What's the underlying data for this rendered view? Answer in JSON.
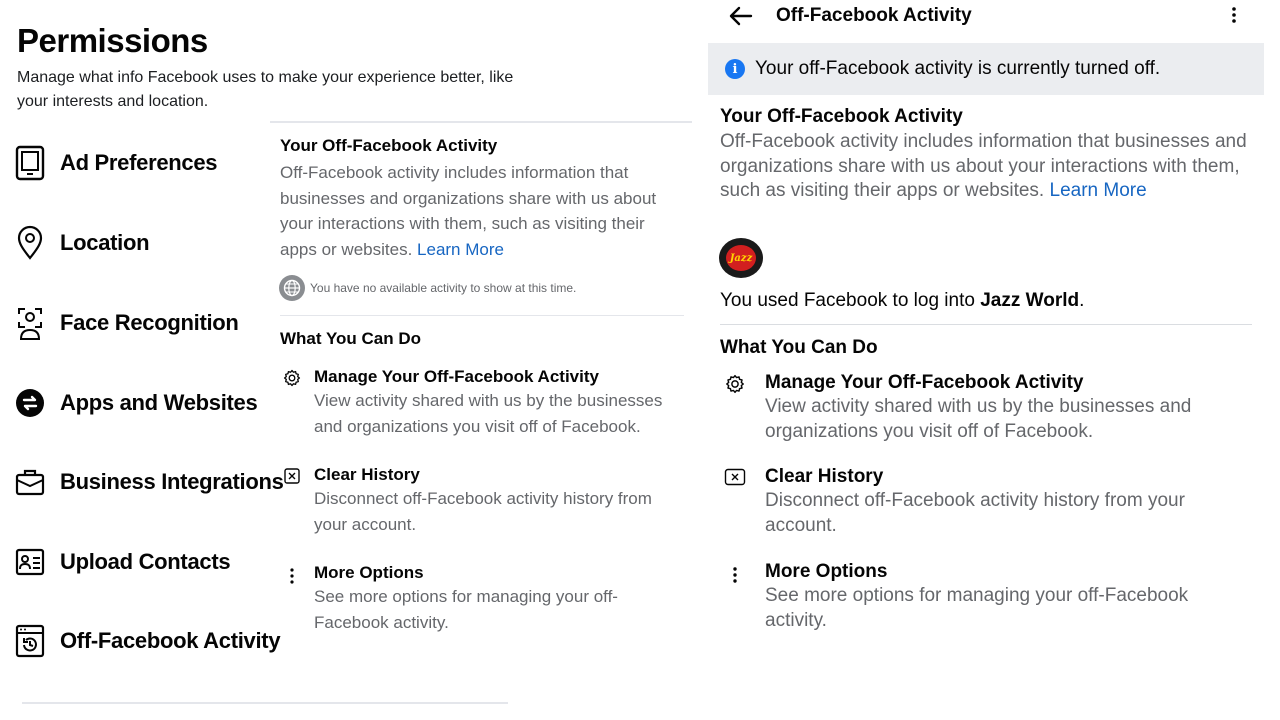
{
  "permissions": {
    "title": "Permissions",
    "subtitle": "Manage what info Facebook uses to make your experience better, like your interests and location.",
    "menu": [
      {
        "label": "Ad Preferences",
        "icon": "tablet-icon"
      },
      {
        "label": "Location",
        "icon": "location-pin-icon"
      },
      {
        "label": "Face Recognition",
        "icon": "face-scan-icon"
      },
      {
        "label": "Apps and Websites",
        "icon": "apps-websites-icon"
      },
      {
        "label": "Business Integrations",
        "icon": "briefcase-icon"
      },
      {
        "label": "Upload Contacts",
        "icon": "contact-card-icon"
      },
      {
        "label": "Off-Facebook Activity",
        "icon": "activity-history-icon"
      }
    ]
  },
  "left_panel": {
    "section_title": "Your Off-Facebook Activity",
    "description": "Off-Facebook activity includes information that businesses and organizations share with us about your interactions with them, such as visiting their apps or websites.",
    "learn_more": "Learn More",
    "no_activity": "You have no available activity to show at this time.",
    "what_you_can_do": "What You Can Do",
    "options": [
      {
        "title": "Manage Your Off-Facebook Activity",
        "description": "View activity shared with us by the businesses and organizations you visit off of Facebook.",
        "icon": "gear-icon"
      },
      {
        "title": "Clear History",
        "description": "Disconnect off-Facebook activity history from your account.",
        "icon": "clear-box-icon"
      },
      {
        "title": "More Options",
        "description": "See more options for managing your off-Facebook activity.",
        "icon": "more-vertical-icon"
      }
    ]
  },
  "right_panel": {
    "header_title": "Off-Facebook Activity",
    "banner": "Your off-Facebook activity is currently turned off.",
    "section_title": "Your Off-Facebook Activity",
    "description": "Off-Facebook activity includes information that businesses and organizations share with us about your interactions with them, such as visiting their apps or websites.",
    "learn_more": "Learn More",
    "logo_text": "Jazz",
    "used_prefix": "You used Facebook to log into ",
    "used_app": "Jazz World",
    "used_suffix": ".",
    "what_you_can_do": "What You Can Do",
    "options": [
      {
        "title": "Manage Your Off-Facebook Activity",
        "description": "View activity shared with us by the businesses and organizations you visit off of Facebook.",
        "icon": "gear-icon"
      },
      {
        "title": "Clear History",
        "description": "Disconnect off-Facebook activity history from your account.",
        "icon": "clear-box-icon"
      },
      {
        "title": "More Options",
        "description": "See more options for managing your off-Facebook activity.",
        "icon": "more-vertical-icon"
      }
    ]
  },
  "colors": {
    "link": "#1766c2",
    "accent": "#1877f2",
    "muted_text": "#65676b",
    "banner_bg": "#ebedf0"
  }
}
